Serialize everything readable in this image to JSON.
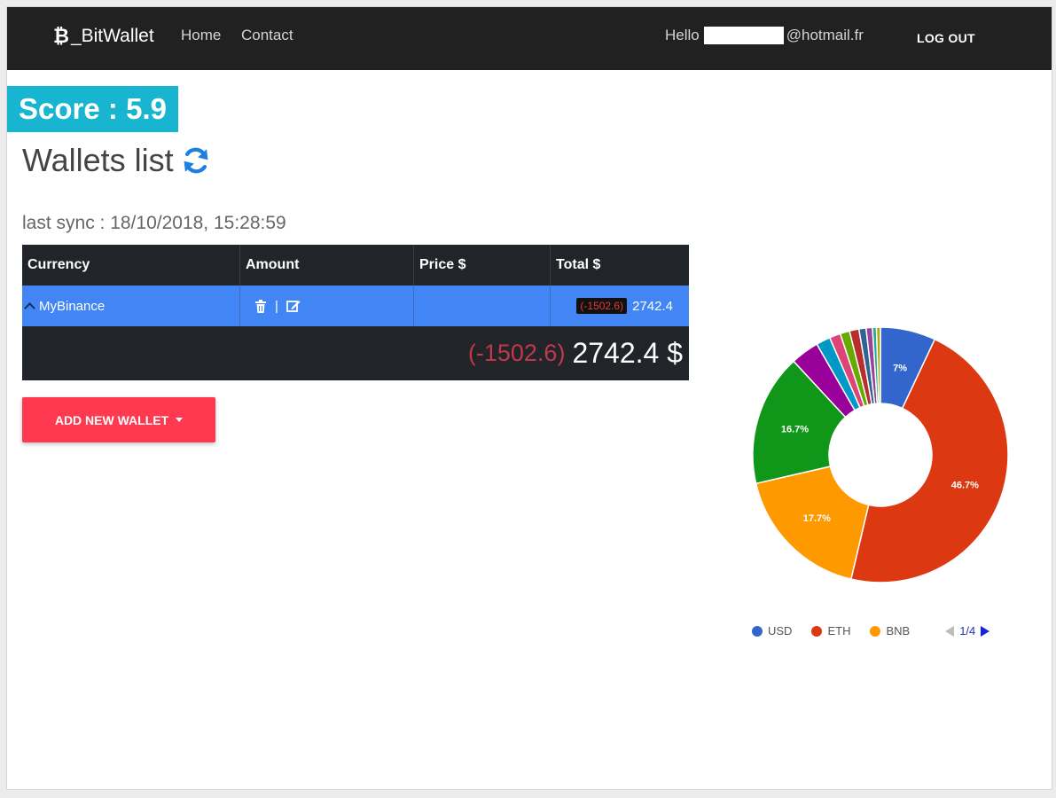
{
  "navbar": {
    "brand_symbol": "₿",
    "brand_text": "_BitWallet",
    "links": [
      {
        "label": "Home"
      },
      {
        "label": "Contact"
      }
    ],
    "greeting": "Hello",
    "email_suffix": "@hotmail.fr",
    "logout_label": "LOG OUT"
  },
  "score": {
    "label": "Score : 5.9"
  },
  "page": {
    "title": "Wallets list",
    "last_sync": "last sync : 18/10/2018, 15:28:59"
  },
  "table": {
    "headers": [
      "Currency",
      "Amount",
      "Price $",
      "Total $"
    ],
    "wallet": {
      "name": "MyBinance",
      "actions_separator": "|",
      "change": "(-1502.6)",
      "total": "2742.4"
    },
    "footer": {
      "change": "(-1502.6)",
      "total": "2742.4 $"
    }
  },
  "add_wallet": {
    "label": "ADD NEW WALLET"
  },
  "colors": {
    "accent": "#ff3a50",
    "score": "#17b5cf",
    "navbar": "#212121",
    "row": "#4285f4"
  },
  "chart_data": {
    "type": "pie",
    "donut": true,
    "slices": [
      {
        "label": "USD",
        "value": 7.0,
        "color": "#3366cc",
        "show_label": true,
        "text": "7%"
      },
      {
        "label": "ETH",
        "value": 46.7,
        "color": "#dc3912",
        "show_label": true,
        "text": "46.7%"
      },
      {
        "label": "BNB",
        "value": 17.7,
        "color": "#ff9900",
        "show_label": true,
        "text": "17.7%"
      },
      {
        "label": "",
        "value": 16.7,
        "color": "#109618",
        "show_label": true,
        "text": "16.7%"
      },
      {
        "label": "",
        "value": 3.6,
        "color": "#990099",
        "show_label": false,
        "text": ""
      },
      {
        "label": "",
        "value": 1.8,
        "color": "#0099c6",
        "show_label": false,
        "text": ""
      },
      {
        "label": "",
        "value": 1.4,
        "color": "#dd4477",
        "show_label": false,
        "text": ""
      },
      {
        "label": "",
        "value": 1.2,
        "color": "#66aa00",
        "show_label": false,
        "text": ""
      },
      {
        "label": "",
        "value": 1.2,
        "color": "#b82e2e",
        "show_label": false,
        "text": ""
      },
      {
        "label": "",
        "value": 0.9,
        "color": "#316395",
        "show_label": false,
        "text": ""
      },
      {
        "label": "",
        "value": 0.8,
        "color": "#994499",
        "show_label": false,
        "text": ""
      },
      {
        "label": "",
        "value": 0.5,
        "color": "#22aa99",
        "show_label": false,
        "text": ""
      },
      {
        "label": "",
        "value": 0.5,
        "color": "#aaaa11",
        "show_label": false,
        "text": ""
      }
    ],
    "legend": {
      "position": "bottom",
      "entries": [
        "USD",
        "ETH",
        "BNB"
      ],
      "page": "1/4"
    }
  }
}
